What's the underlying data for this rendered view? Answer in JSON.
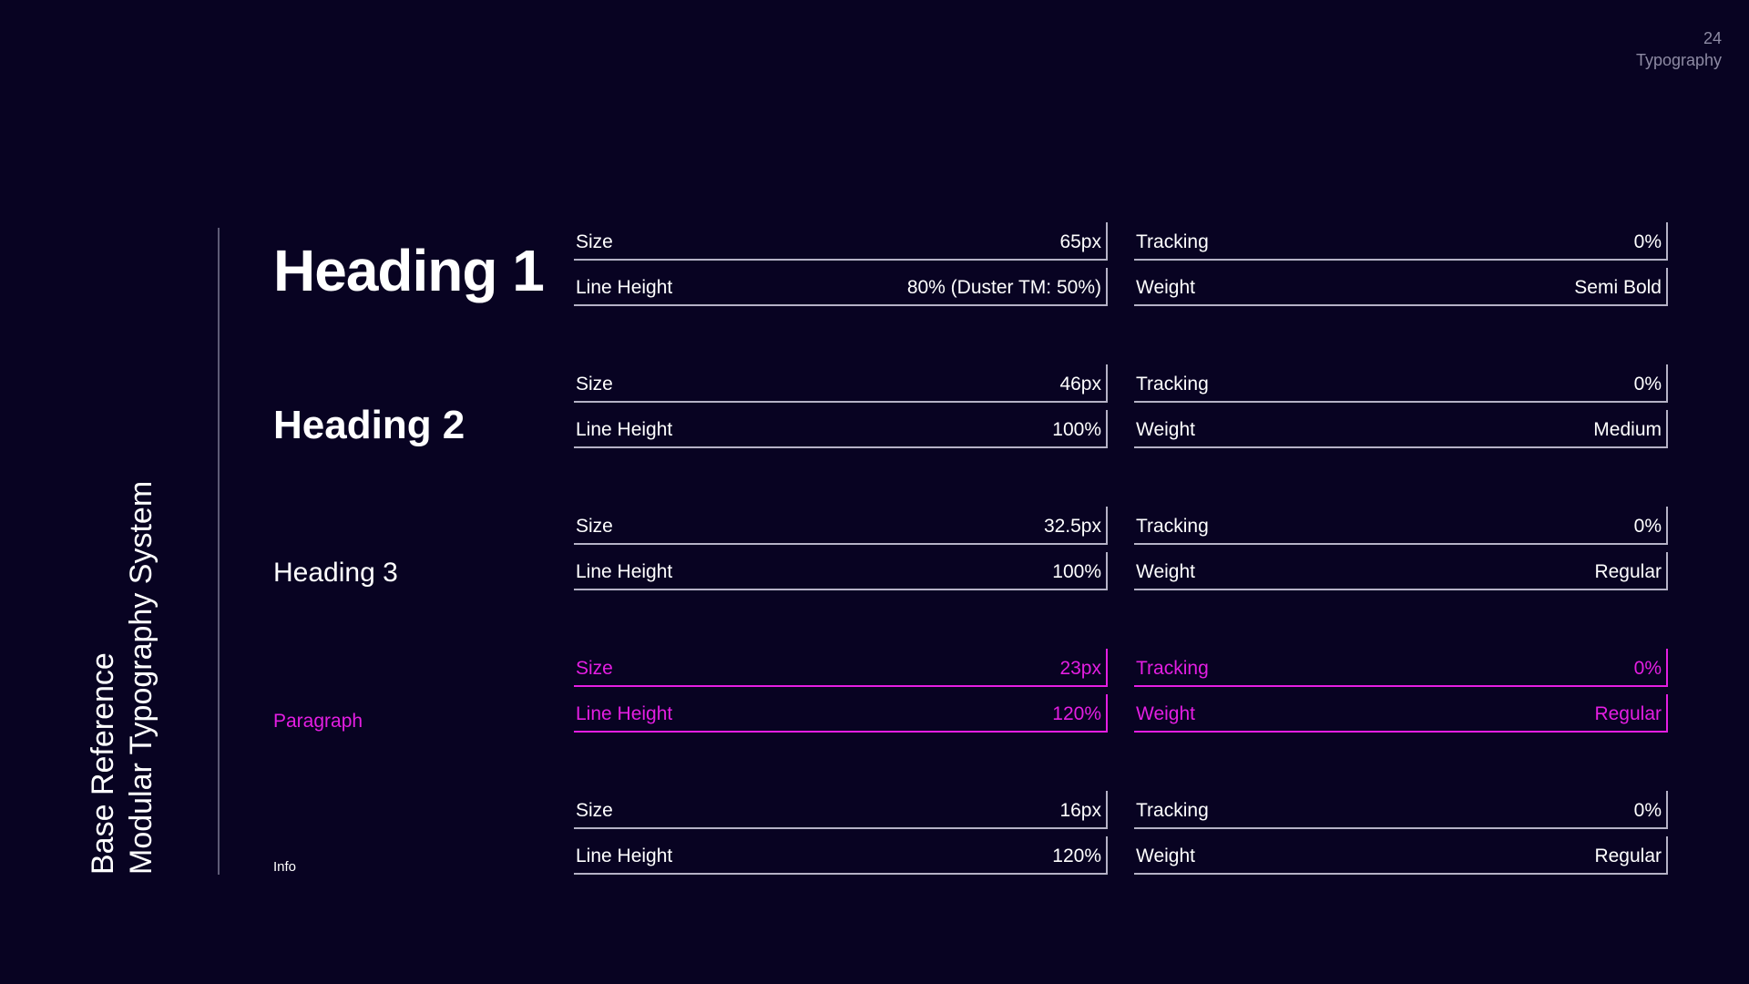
{
  "slide": {
    "page_number": "24",
    "section": "Typography"
  },
  "side_title": {
    "line1": "Base Reference",
    "line2": "Modular Typography System"
  },
  "colors": {
    "background": "#080322",
    "text": "#ffffff",
    "accent": "#e41ee2",
    "muted": "#8d8aa3"
  },
  "styles": [
    {
      "label": "Heading 1",
      "specs": {
        "size_label": "Size",
        "size": "65px",
        "line_height_label": "Line Height",
        "line_height": "80% (Duster TM: 50%)",
        "tracking_label": "Tracking",
        "tracking": "0%",
        "weight_label": "Weight",
        "weight": "Semi Bold"
      }
    },
    {
      "label": "Heading 2",
      "specs": {
        "size_label": "Size",
        "size": "46px",
        "line_height_label": "Line Height",
        "line_height": "100%",
        "tracking_label": "Tracking",
        "tracking": "0%",
        "weight_label": "Weight",
        "weight": "Medium"
      }
    },
    {
      "label": "Heading 3",
      "specs": {
        "size_label": "Size",
        "size": "32.5px",
        "line_height_label": "Line Height",
        "line_height": "100%",
        "tracking_label": "Tracking",
        "tracking": "0%",
        "weight_label": "Weight",
        "weight": "Regular"
      }
    },
    {
      "label": "Paragraph",
      "specs": {
        "size_label": "Size",
        "size": "23px",
        "line_height_label": "Line Height",
        "line_height": "120%",
        "tracking_label": "Tracking",
        "tracking": "0%",
        "weight_label": "Weight",
        "weight": "Regular"
      }
    },
    {
      "label": "Info",
      "specs": {
        "size_label": "Size",
        "size": "16px",
        "line_height_label": "Line Height",
        "line_height": "120%",
        "tracking_label": "Tracking",
        "tracking": "0%",
        "weight_label": "Weight",
        "weight": "Regular"
      }
    }
  ]
}
